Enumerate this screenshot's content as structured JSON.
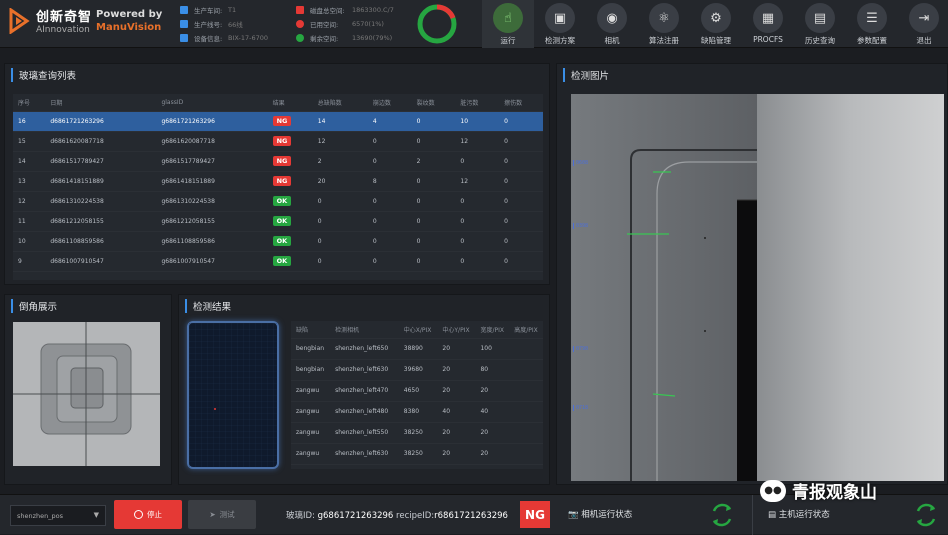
{
  "header": {
    "logo_cn": "创新奇智",
    "logo_en": "AInnovation",
    "powered_by": "Powered by",
    "powered_brand": "ManuVision",
    "info_left": [
      {
        "label": "生产车间:",
        "value": "T1"
      },
      {
        "label": "生产线号:",
        "value": "66线"
      },
      {
        "label": "设备信息:",
        "value": "BIX-17-6700"
      }
    ],
    "info_right": [
      {
        "label": "磁盘总空间:",
        "value": "1863300.C/7"
      },
      {
        "label": "已用空间:",
        "value": "6570(1%)"
      },
      {
        "label": "剩余空间:",
        "value": "13690(79%)"
      }
    ],
    "toolbar": [
      {
        "label": "运行",
        "icon": "run-hand-icon",
        "active": true
      },
      {
        "label": "检测方案",
        "icon": "scheme-icon",
        "active": false
      },
      {
        "label": "相机",
        "icon": "camera-icon",
        "active": false
      },
      {
        "label": "算法注册",
        "icon": "algorithm-atom-icon",
        "active": false
      },
      {
        "label": "缺陷管理",
        "icon": "gear-icon",
        "active": false
      },
      {
        "label": "PROCFS",
        "icon": "procfs-icon",
        "active": false
      },
      {
        "label": "历史查询",
        "icon": "history-icon",
        "active": false
      },
      {
        "label": "参数配置",
        "icon": "params-icon",
        "active": false
      },
      {
        "label": "退出",
        "icon": "exit-icon",
        "active": false
      }
    ]
  },
  "glass_list": {
    "title": "玻璃查询列表",
    "columns": [
      "序号",
      "日期",
      "glassID",
      "结果",
      "总缺陷数",
      "崩边数",
      "裂纹数",
      "脏污数",
      "擦伤数"
    ],
    "rows": [
      {
        "idx": "16",
        "date": "d6861721263296",
        "gid": "g6861721263296",
        "result": "NG",
        "total": "14",
        "a": "4",
        "b": "0",
        "c": "10",
        "d": "0",
        "selected": true
      },
      {
        "idx": "15",
        "date": "d6861620087718",
        "gid": "g6861620087718",
        "result": "NG",
        "total": "12",
        "a": "0",
        "b": "0",
        "c": "12",
        "d": "0",
        "selected": false
      },
      {
        "idx": "14",
        "date": "d6861517789427",
        "gid": "g6861517789427",
        "result": "NG",
        "total": "2",
        "a": "0",
        "b": "2",
        "c": "0",
        "d": "0",
        "selected": false
      },
      {
        "idx": "13",
        "date": "d6861418151889",
        "gid": "g6861418151889",
        "result": "NG",
        "total": "20",
        "a": "8",
        "b": "0",
        "c": "12",
        "d": "0",
        "selected": false
      },
      {
        "idx": "12",
        "date": "d6861310224538",
        "gid": "g6861310224538",
        "result": "OK",
        "total": "0",
        "a": "0",
        "b": "0",
        "c": "0",
        "d": "0",
        "selected": false
      },
      {
        "idx": "11",
        "date": "d6861212058155",
        "gid": "g6861212058155",
        "result": "OK",
        "total": "0",
        "a": "0",
        "b": "0",
        "c": "0",
        "d": "0",
        "selected": false
      },
      {
        "idx": "10",
        "date": "d6861108859586",
        "gid": "g6861108859586",
        "result": "OK",
        "total": "0",
        "a": "0",
        "b": "0",
        "c": "0",
        "d": "0",
        "selected": false
      },
      {
        "idx": "9",
        "date": "d6861007910547",
        "gid": "g6861007910547",
        "result": "OK",
        "total": "0",
        "a": "0",
        "b": "0",
        "c": "0",
        "d": "0",
        "selected": false
      }
    ]
  },
  "chamfer": {
    "title": "倒角展示"
  },
  "detect_result": {
    "title": "检测结果",
    "columns": [
      "缺陷",
      "检测相机",
      "中心X/PIX",
      "中心Y/PIX",
      "宽度/PIX",
      "高度/PIX"
    ],
    "rows": [
      {
        "defect": "bengbian",
        "camera": "shenzhen_left650",
        "cx": "38890",
        "cy": "20",
        "w": "100"
      },
      {
        "defect": "bengbian",
        "camera": "shenzhen_left630",
        "cx": "39680",
        "cy": "20",
        "w": "80"
      },
      {
        "defect": "zangwu",
        "camera": "shenzhen_left470",
        "cx": "4650",
        "cy": "20",
        "w": "20"
      },
      {
        "defect": "zangwu",
        "camera": "shenzhen_left480",
        "cx": "8380",
        "cy": "40",
        "w": "40"
      },
      {
        "defect": "zangwu",
        "camera": "shenzhen_left550",
        "cx": "38250",
        "cy": "20",
        "w": "20"
      },
      {
        "defect": "zangwu",
        "camera": "shenzhen_left630",
        "cx": "38250",
        "cy": "20",
        "w": "20"
      }
    ]
  },
  "detect_image": {
    "title": "检测图片",
    "ruler_labels": [
      "0608",
      "0398",
      "0790",
      "0718"
    ]
  },
  "bottom": {
    "select_value": "shenzhen_pos",
    "stop_label": "停止",
    "test_label": "测试",
    "glass_id_label": "玻璃ID:",
    "glass_id": "g6861721263296",
    "recipe_label": "recipeID:",
    "recipe_id": "r6861721263296",
    "result": "NG",
    "camera_status": "相机运行状态",
    "host_status": "主机运行状态",
    "watermark": "青报观象山"
  },
  "colors": {
    "accent": "#3a8ee6",
    "ng": "#e53935",
    "ok": "#26a641",
    "green": "#26a641"
  }
}
